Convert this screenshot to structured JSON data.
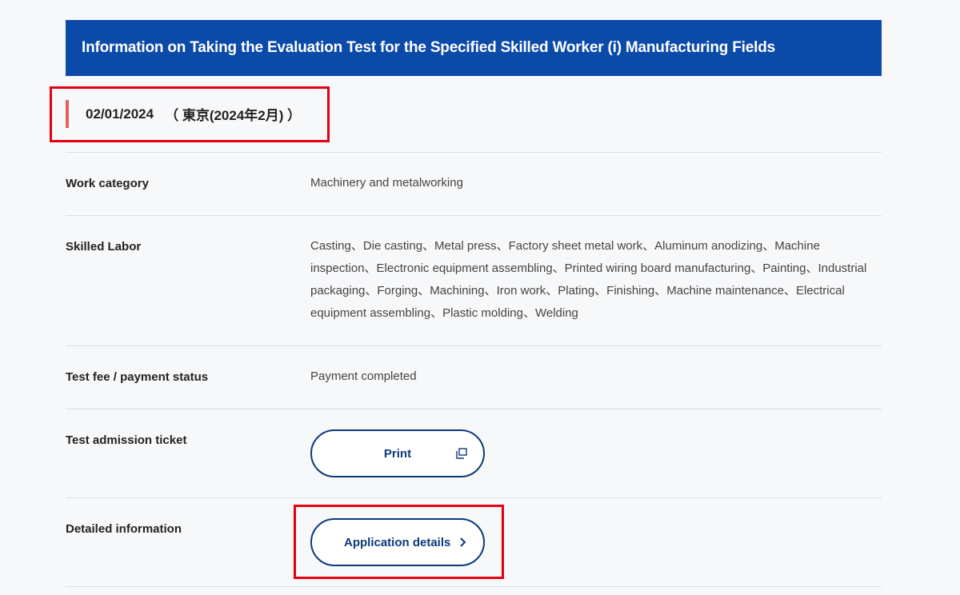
{
  "header": {
    "title": "Information on Taking the Evaluation Test for the Specified Skilled Worker (i) Manufacturing Fields"
  },
  "session": {
    "date": "02/01/2024",
    "location": "（ 東京(2024年2月) ）"
  },
  "rows": {
    "work_category": {
      "label": "Work category",
      "value": "Machinery and metalworking"
    },
    "skilled_labor": {
      "label": "Skilled Labor",
      "value": "Casting、Die casting、Metal press、Factory sheet metal work、Aluminum anodizing、Machine inspection、Electronic equipment assembling、Printed wiring board manufacturing、Painting、Industrial packaging、Forging、Machining、Iron work、Plating、Finishing、Machine maintenance、Electrical equipment assembling、Plastic molding、Welding"
    },
    "test_fee": {
      "label": "Test fee / payment status",
      "value": "Payment completed"
    },
    "admission_ticket": {
      "label": "Test admission ticket",
      "button": "Print"
    },
    "detailed_info": {
      "label": "Detailed information",
      "button": "Application details"
    }
  },
  "colors": {
    "banner": "#0b4aa8",
    "button_border": "#0b3a7a",
    "accent_bar": "#e8605a",
    "highlight": "#e30012"
  },
  "icons": {
    "print": "external-window-icon",
    "details": "chevron-right-icon"
  }
}
